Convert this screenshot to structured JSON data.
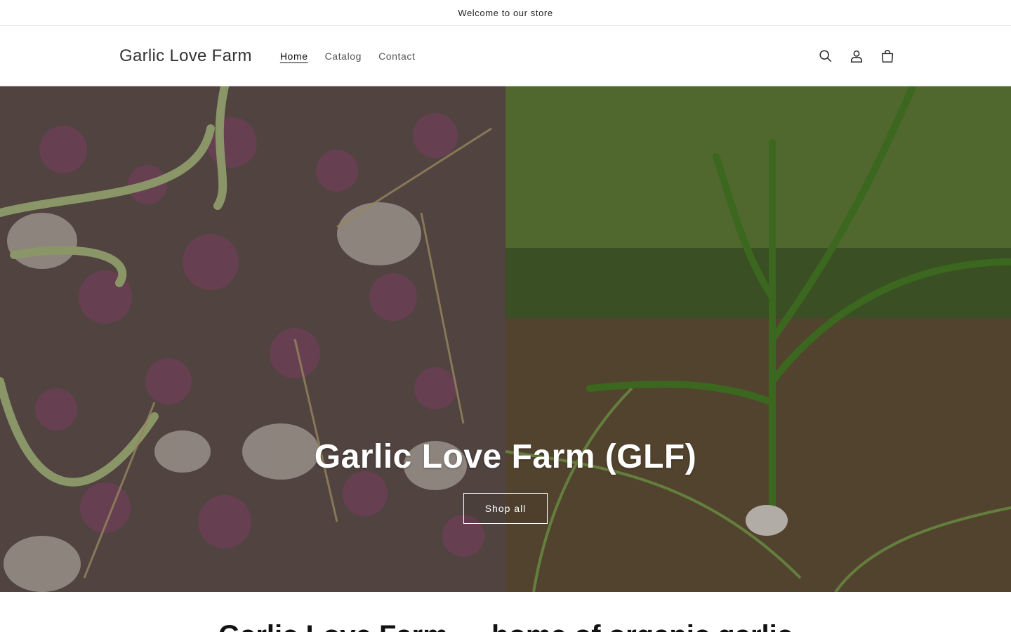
{
  "announcement": {
    "text": "Welcome to our store"
  },
  "header": {
    "logo": "Garlic Love Farm",
    "nav": [
      {
        "label": "Home",
        "active": true
      },
      {
        "label": "Catalog",
        "active": false
      },
      {
        "label": "Contact",
        "active": false
      }
    ],
    "icons": [
      "search-icon",
      "account-icon",
      "cart-icon"
    ]
  },
  "hero": {
    "title": "Garlic Love Farm (GLF)",
    "button_label": "Shop all",
    "left_image": "harvested-garlic-bulbs",
    "right_image": "garlic-plant-in-field"
  },
  "section": {
    "title": "Garlic Love Farm — home of organic garlic"
  },
  "colors": {
    "text": "#121212",
    "border": "#e6e6e6",
    "hero_text": "#ffffff"
  }
}
